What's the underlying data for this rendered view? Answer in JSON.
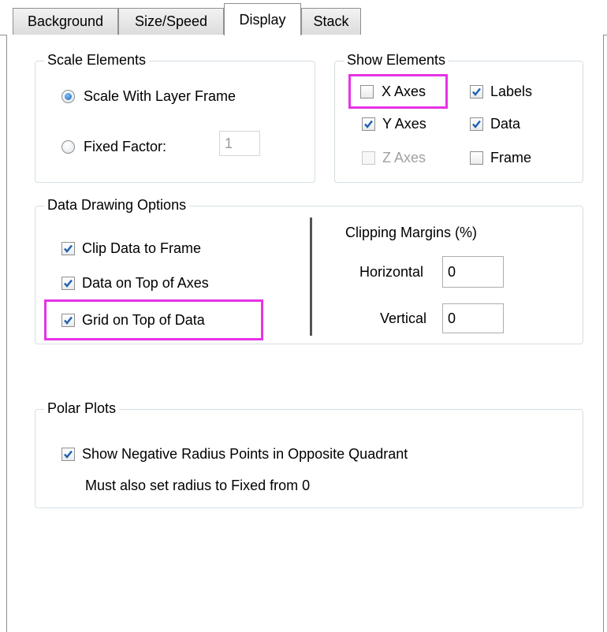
{
  "tabs": [
    "Background",
    "Size/Speed",
    "Display",
    "Stack"
  ],
  "active_tab": "Display",
  "scale_elements": {
    "title": "Scale Elements",
    "scale_with_layer_frame": "Scale With Layer Frame",
    "fixed_factor": "Fixed Factor:",
    "fixed_factor_value": "1"
  },
  "show_elements": {
    "title": "Show Elements",
    "x_axes": "X Axes",
    "y_axes": "Y Axes",
    "z_axes": "Z Axes",
    "labels": "Labels",
    "data": "Data",
    "frame": "Frame"
  },
  "data_drawing": {
    "title": "Data Drawing Options",
    "clip_data": "Clip Data to Frame",
    "data_on_top": "Data on Top of Axes",
    "grid_on_top": "Grid on Top of Data",
    "clipping_title": "Clipping Margins (%)",
    "horizontal": "Horizontal",
    "horizontal_value": "0",
    "vertical": "Vertical",
    "vertical_value": "0"
  },
  "polar": {
    "title": "Polar Plots",
    "show_negative": "Show Negative Radius Points in Opposite Quadrant",
    "note": "Must also set radius to Fixed from 0"
  },
  "colors": {
    "highlight": "#e633e6",
    "check": "#1f5fb0"
  }
}
